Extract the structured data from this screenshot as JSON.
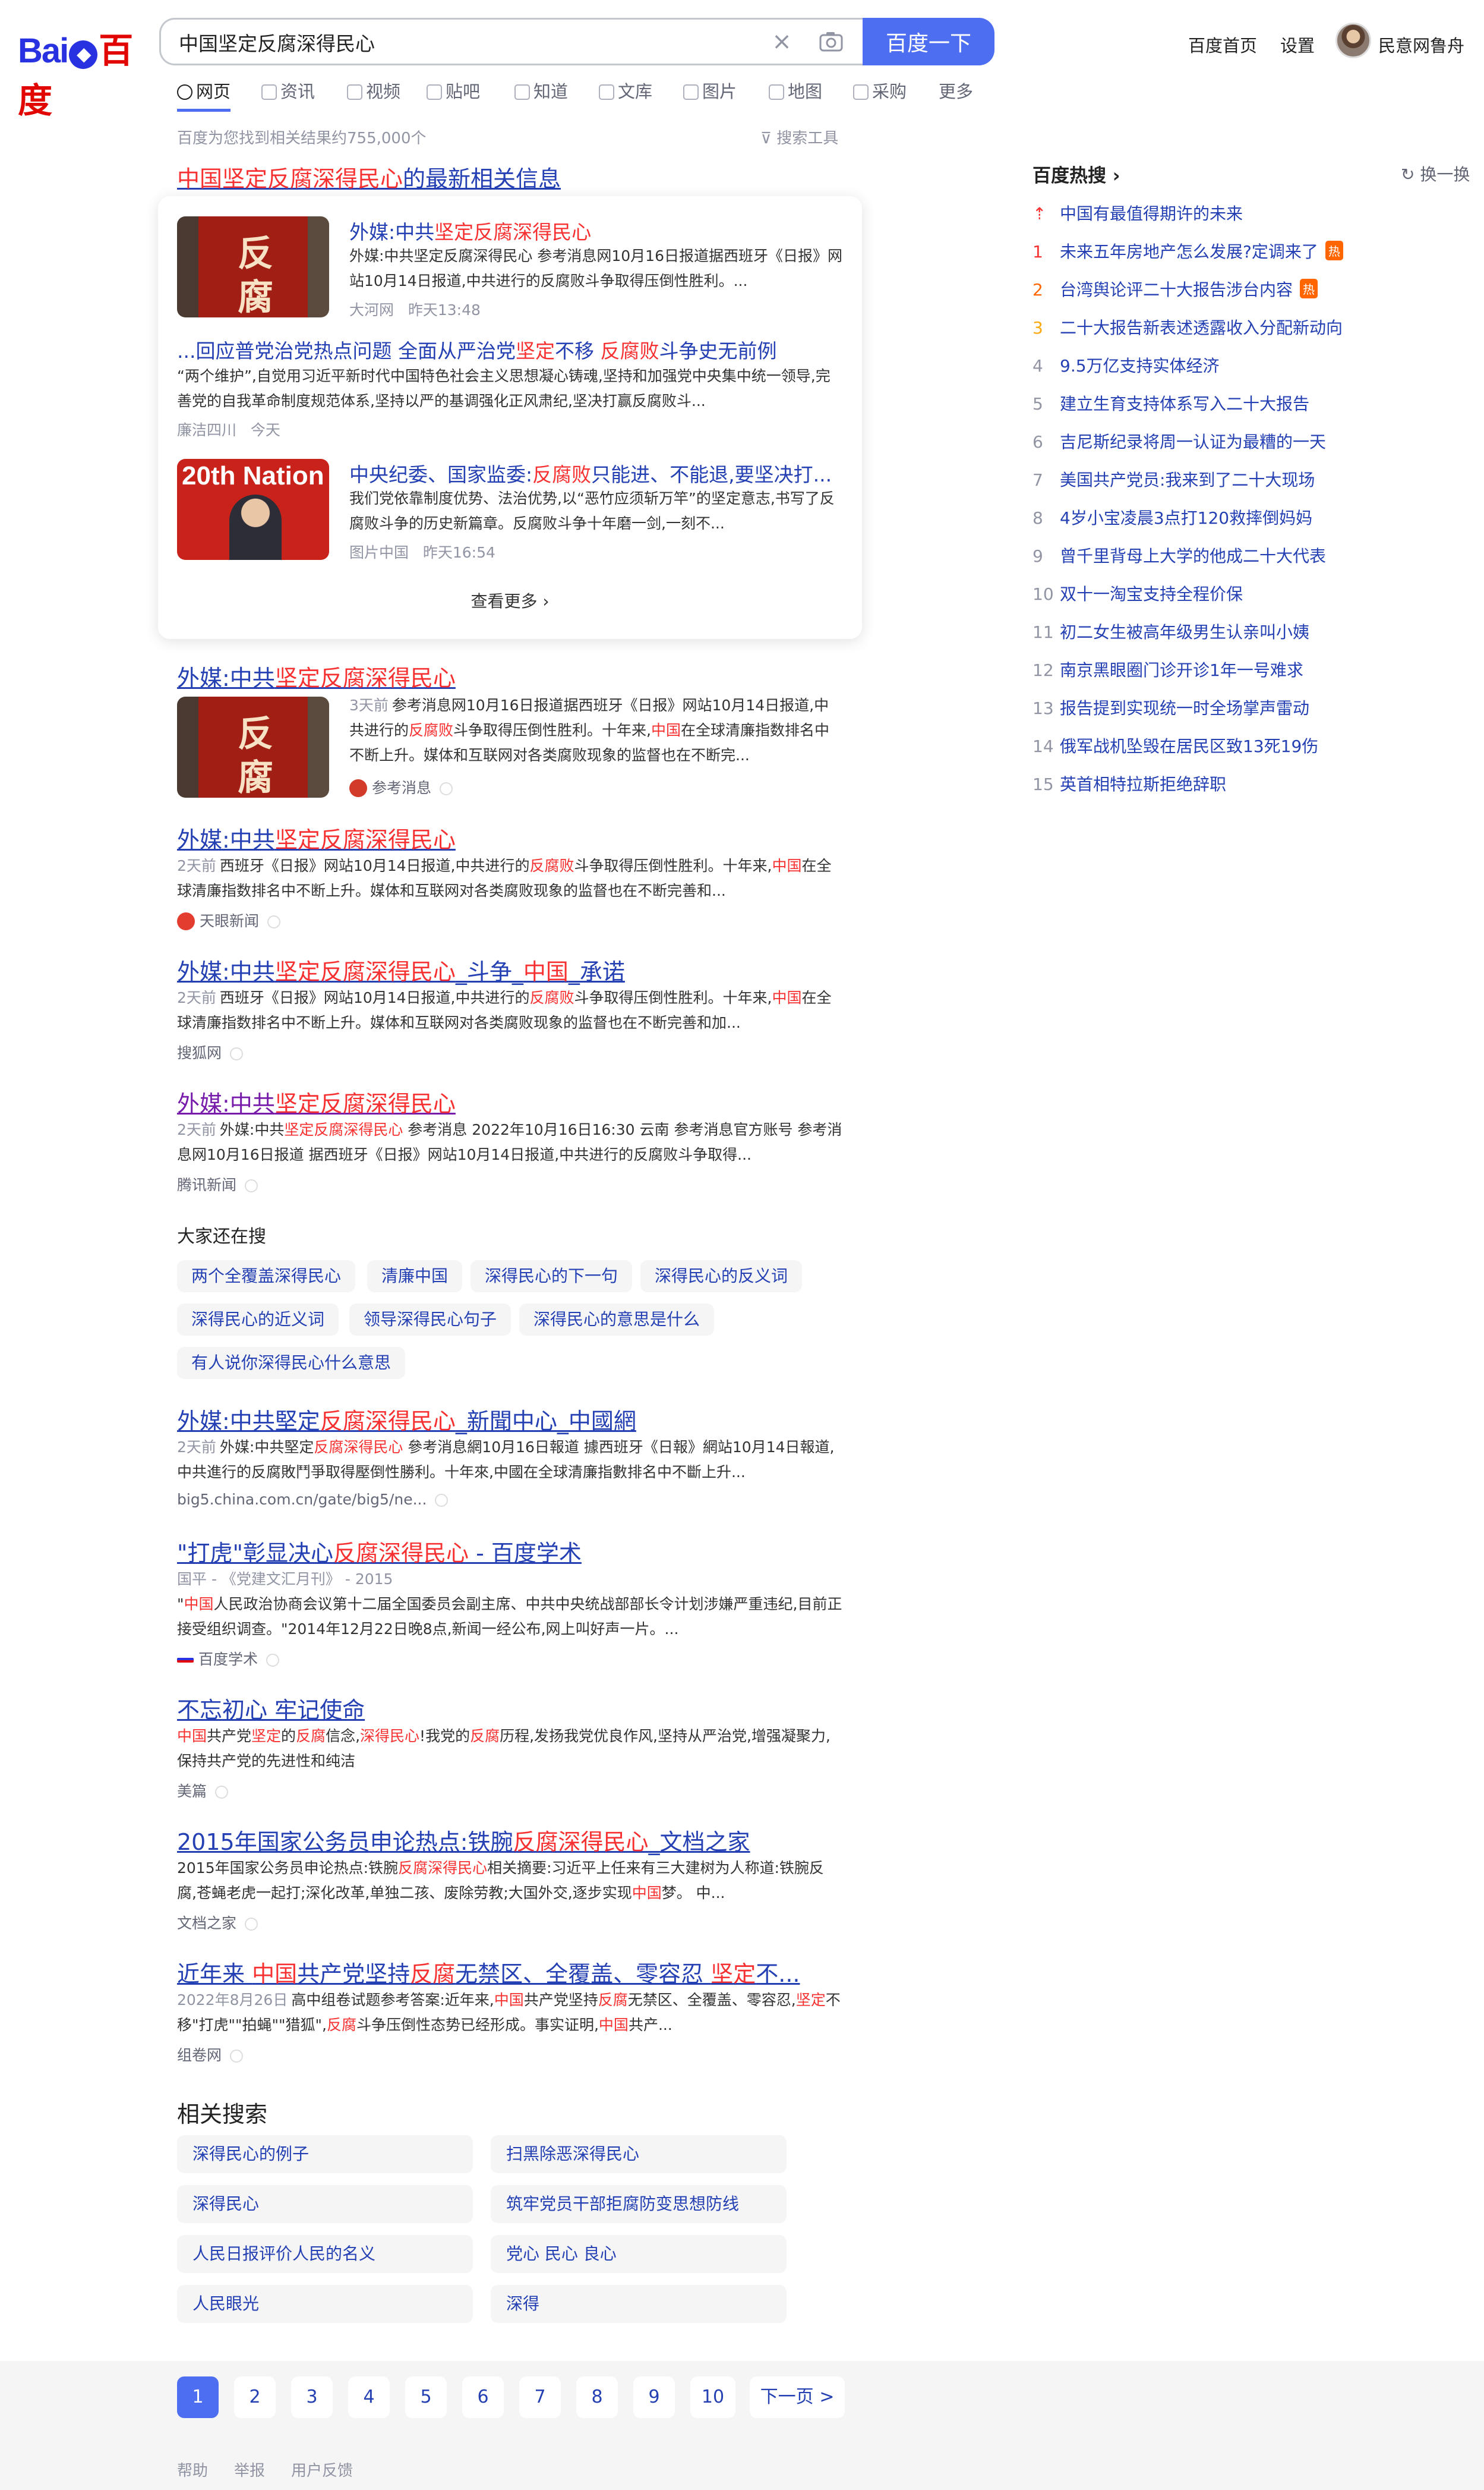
{
  "header": {
    "logo_text_1": "Bai",
    "logo_text_2": "百度",
    "search_value": "中国坚定反腐深得民心",
    "search_button": "百度一下",
    "link_home": "百度首页",
    "link_settings": "设置",
    "username": "民意网鲁舟"
  },
  "tabs": [
    {
      "label": "网页"
    },
    {
      "label": "资讯"
    },
    {
      "label": "视频"
    },
    {
      "label": "贴吧"
    },
    {
      "label": "知道"
    },
    {
      "label": "文库"
    },
    {
      "label": "图片"
    },
    {
      "label": "地图"
    },
    {
      "label": "采购"
    },
    {
      "label": "更多"
    }
  ],
  "result_count": "百度为您找到相关结果约755,000个",
  "search_tools": "搜索工具",
  "news": {
    "title_hl": "中国坚定反腐深得民心",
    "title_rest": "的最新相关信息",
    "items": [
      {
        "t1": "外媒:中共",
        "t2": "坚定反腐深得民心",
        "abs": "外媒:中共坚定反腐深得民心 参考消息网10月16日报道据西班牙《日报》网站10月14日报道,中共进行的反腐败斗争取得压倒性胜利。...",
        "src": "大河网",
        "time": "昨天13:48",
        "thumb_text": "反腐"
      },
      {
        "t1": "...回应普党治党热点问题 全面从严治党",
        "t2": "坚定",
        "t3": "不移 ",
        "t4": "反腐败",
        "t5": "斗争史无前例",
        "abs": "“两个维护”,自觉用习近平新时代中国特色社会主义思想凝心铸魂,坚持和加强党中央集中统一领导,完善党的自我革命制度规范体系,坚持以严的基调强化正风肃纪,坚决打赢反腐败斗...",
        "src": "廉洁四川",
        "time": "今天"
      },
      {
        "t1": "中央纪委、国家监委:",
        "t2": "反腐败",
        "t3": "只能进、不能退,要坚决打...",
        "abs": "我们党依靠制度优势、法治优势,以“恶竹应须斩万竿”的坚定意志,书写了反腐败斗争的历史新篇章。反腐败斗争十年磨一剑,一刻不...",
        "src": "图片中国",
        "time": "昨天16:54",
        "thumb_text": "20th Nation"
      }
    ],
    "more": "查看更多 ›"
  },
  "results": [
    {
      "t1": "外媒:中共",
      "t2": "坚定反腐深得民心",
      "date": "3天前",
      "a1": "参考消息网10月16日报道据西班牙《日报》网站10月14日报道,中共进行的",
      "a2": "反腐败",
      "a3": "斗争取得压倒性胜利。十年来,",
      "a4": "中国",
      "a5": "在全球清廉指数排名中不断上升。媒体和互联网对各类腐败现象的监督也在不断完...",
      "src": "参考消息"
    },
    {
      "t1": "外媒:中共",
      "t2": "坚定反腐深得民心",
      "date": "2天前",
      "a1": "西班牙《日报》网站10月14日报道,中共进行的",
      "a2": "反腐败",
      "a3": "斗争取得压倒性胜利。十年来,",
      "a4": "中国",
      "a5": "在全球清廉指数排名中不断上升。媒体和互联网对各类腐败现象的监督也在不断完善和...",
      "src": "天眼新闻"
    },
    {
      "t1": "外媒:中共",
      "t2": "坚定反腐深得民心",
      "t3": "_斗争_",
      "t4": "中国",
      "t5": "_承诺",
      "date": "2天前",
      "a1": "西班牙《日报》网站10月14日报道,中共进行的",
      "a2": "反腐败",
      "a3": "斗争取得压倒性胜利。十年来,",
      "a4": "中国",
      "a5": "在全球清廉指数排名中不断上升。媒体和互联网对各类腐败现象的监督也在不断完善和加...",
      "src": "搜狐网"
    },
    {
      "t1": "外媒:中共",
      "t2": "坚定反腐深得民心",
      "date": "2天前",
      "a1": "外媒:中共",
      "a2": "坚定反腐深得民心",
      "a3": " 参考消息 2022年10月16日16:30 云南 参考消息官方账号 参考消息网10月16日报道 据西班牙《日报》网站10月14日报道,中共进行的反腐败斗争取得...",
      "src": "腾讯新闻"
    }
  ],
  "also": {
    "title": "大家还在搜",
    "chips": [
      "两个全覆盖深得民心",
      "清廉中国",
      "深得民心的下一句",
      "深得民心的反义词",
      "深得民心的近义词",
      "领导深得民心句子",
      "深得民心的意思是什么",
      "有人说你深得民心什么意思"
    ]
  },
  "results2": [
    {
      "t1": "外媒:中共堅定",
      "t2": "反腐深得民心",
      "t3": "_新聞中心_中國網",
      "date": "2天前",
      "a1": "外媒:中共堅定",
      "a2": "反腐深得民心",
      "a3": " 參考消息網10月16日報道 據西班牙《日報》網站10月14日報道,中共進行的反腐敗鬥爭取得壓倒性勝利。十年來,中國在全球清廉指數排名中不斷上升...",
      "src": "big5.china.com.cn/gate/big5/ne..."
    },
    {
      "t1": "\"打虎\"彰显决心",
      "t2": "反腐深得民心",
      "t3": " - 百度学术",
      "meta": "国平 - 《党建文汇月刊》 - 2015",
      "a1": "\"",
      "a2": "中国",
      "a3": "人民政治协商会议第十二届全国委员会副主席、中共中央统战部部长令计划涉嫌严重违纪,目前正接受组织调查。\"2014年12月22日晚8点,新闻一经公布,网上叫好声一片。...",
      "src": "百度学术"
    },
    {
      "t1": "不忘初心 牢记使命",
      "a2": "中国",
      "a3": "共产党",
      "a4": "坚定",
      "a5": "的",
      "a6": "反腐",
      "a7": "信念,",
      "a8": "深得民心",
      "a9": "!我党的",
      "a10": "反腐",
      "a11": "历程,发扬我党优良作风,坚持从严治党,增强凝聚力,保持共产党的先进性和纯洁",
      "src": "美篇"
    },
    {
      "t1": "2015年国家公务员申论热点:铁腕",
      "t2": "反腐深得民心",
      "t3": "_文档之家",
      "a1": "2015年国家公务员申论热点:铁腕",
      "a2": "反腐深得民心",
      "a3": "相关摘要:习近平上任来有三大建树为人称道:铁腕反腐,苍蝇老虎一起打;深化改革,单独二孩、废除劳教;大国外交,逐步实现",
      "a4": "中国",
      "a5": "梦。 中...",
      "src": "文档之家"
    },
    {
      "t1": "近年来 ",
      "t2": "中国",
      "t3": "共产党坚持",
      "t4": "反腐",
      "t5": "无禁区、全覆盖、零容忍 ",
      "t6": "坚定",
      "t7": "不...",
      "date": "2022年8月26日",
      "a1": "高中组卷试题参考答案:近年来,",
      "a2": "中国",
      "a3": "共产党坚持",
      "a4": "反腐",
      "a5": "无禁区、全覆盖、零容忍,",
      "a6": "坚定",
      "a7": "不移\"打虎\"\"拍蝇\"\"猎狐\",",
      "a8": "反腐",
      "a9": "斗争压倒性态势已经形成。事实证明,",
      "a10": "中国",
      "a11": "共产...",
      "src": "组卷网"
    }
  ],
  "related": {
    "title": "相关搜索",
    "items": [
      "深得民心的例子",
      "扫黑除恶深得民心",
      "深得民心",
      "筑牢党员干部拒腐防变思想防线",
      "人民日报评价人民的名义",
      "党心 民心 良心",
      "人民眼光",
      "深得"
    ]
  },
  "hot": {
    "title": "百度热搜 ›",
    "refresh": "换一换",
    "items": [
      {
        "num": "",
        "text": "中国有最值得期许的未来"
      },
      {
        "num": "1",
        "text": "未来五年房地产怎么发展?定调来了",
        "badge": "热"
      },
      {
        "num": "2",
        "text": "台湾舆论评二十大报告涉台内容",
        "badge": "热"
      },
      {
        "num": "3",
        "text": "二十大报告新表述透露收入分配新动向"
      },
      {
        "num": "4",
        "text": "9.5万亿支持实体经济"
      },
      {
        "num": "5",
        "text": "建立生育支持体系写入二十大报告"
      },
      {
        "num": "6",
        "text": "吉尼斯纪录将周一认证为最糟的一天"
      },
      {
        "num": "7",
        "text": "美国共产党员:我来到了二十大现场"
      },
      {
        "num": "8",
        "text": "4岁小宝凌晨3点打120救摔倒妈妈"
      },
      {
        "num": "9",
        "text": "曾千里背母上大学的他成二十大代表"
      },
      {
        "num": "10",
        "text": "双十一淘宝支持全程价保"
      },
      {
        "num": "11",
        "text": "初二女生被高年级男生认亲叫小姨"
      },
      {
        "num": "12",
        "text": "南京黑眼圈门诊开诊1年一号难求"
      },
      {
        "num": "13",
        "text": "报告提到实现统一时全场掌声雷动"
      },
      {
        "num": "14",
        "text": "俄军战机坠毁在居民区致13死19伤"
      },
      {
        "num": "15",
        "text": "英首相特拉斯拒绝辞职"
      }
    ]
  },
  "pagination": {
    "pages": [
      "1",
      "2",
      "3",
      "4",
      "5",
      "6",
      "7",
      "8",
      "9",
      "10"
    ],
    "next": "下一页 >"
  },
  "footer": {
    "help": "帮助",
    "report": "举报",
    "feedback": "用户反馈"
  },
  "colors": {
    "brand_blue": "#4e6ef2",
    "link": "#2440b3",
    "highlight": "#f73131",
    "hot_badge": "#ff6600"
  }
}
